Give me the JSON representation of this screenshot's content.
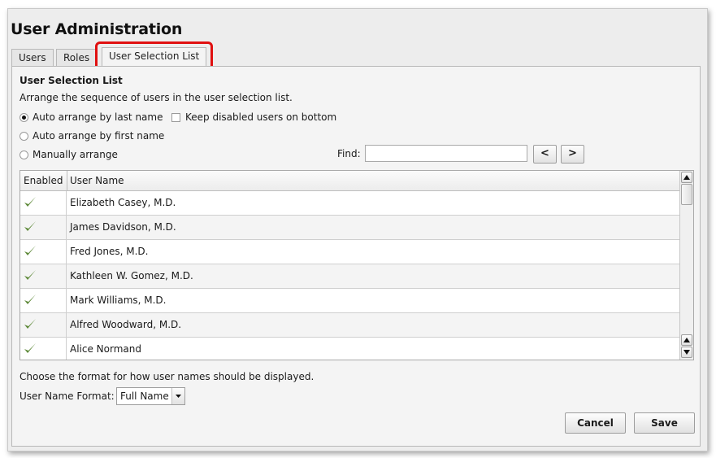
{
  "window": {
    "title": "User Administration"
  },
  "tabs": [
    {
      "label": "Users"
    },
    {
      "label": "Roles"
    },
    {
      "label": "User Selection List"
    }
  ],
  "panel": {
    "title": "User Selection List",
    "description": "Arrange the sequence of users in the user selection list.",
    "arrange_options": [
      {
        "label": "Auto arrange by last name",
        "selected": true
      },
      {
        "label": "Auto arrange by first name",
        "selected": false
      },
      {
        "label": "Manually arrange",
        "selected": false
      }
    ],
    "keep_disabled": {
      "label": "Keep disabled users on bottom",
      "checked": false
    },
    "find": {
      "label": "Find:",
      "value": "",
      "prev_label": "<",
      "next_label": ">"
    },
    "grid": {
      "columns": [
        "Enabled",
        "User Name"
      ],
      "rows": [
        {
          "enabled": true,
          "name": "Elizabeth Casey, M.D."
        },
        {
          "enabled": true,
          "name": "James Davidson, M.D."
        },
        {
          "enabled": true,
          "name": "Fred Jones, M.D."
        },
        {
          "enabled": true,
          "name": "Kathleen W. Gomez, M.D."
        },
        {
          "enabled": true,
          "name": "Mark Williams, M.D."
        },
        {
          "enabled": true,
          "name": "Alfred Woodward, M.D."
        },
        {
          "enabled": true,
          "name": "Alice Normand"
        }
      ]
    },
    "format_description": "Choose the format for how user names should be displayed.",
    "format_label": "User Name Format:",
    "format_value": "Full Name"
  },
  "buttons": {
    "cancel": "Cancel",
    "save": "Save"
  },
  "icons": {
    "check": "check-icon",
    "highlight_color": "#e01010",
    "check_color": "#5f8a3a"
  }
}
